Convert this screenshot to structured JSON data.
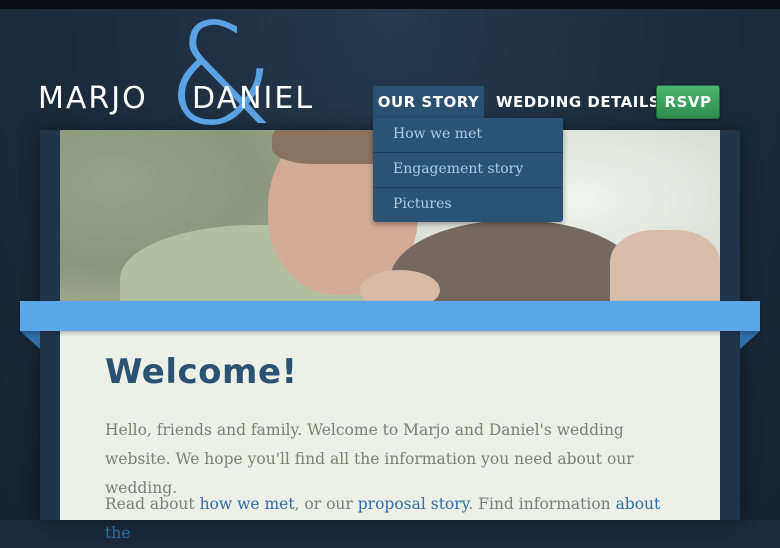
{
  "logo": {
    "name1": "MARJO",
    "amp": "&",
    "name2": "DANIEL"
  },
  "nav": {
    "story": "OUR STORY",
    "details": "WEDDING DETAILS",
    "rsvp": "RSVP",
    "dropdown": [
      "How we met",
      "Engagement story",
      "Pictures"
    ]
  },
  "main": {
    "title": "Welcome!",
    "para1": "Hello, friends and family. Welcome to Marjo and Daniel's wedding website. We hope you'll find all the information you need about our wedding.",
    "para2_pre": "Read about ",
    "link_how": "how we met",
    "para2_mid": ", or our ",
    "link_proposal": "proposal story",
    "para2_post": ". Find information ",
    "link_about": "about the"
  },
  "colors": {
    "background": "#1b2a3a",
    "accent_blue": "#5aa7ea",
    "nav_active": "#2b5070",
    "rsvp_green": "#3aa35f",
    "heading": "#2b5273",
    "link": "#2e6da6"
  }
}
